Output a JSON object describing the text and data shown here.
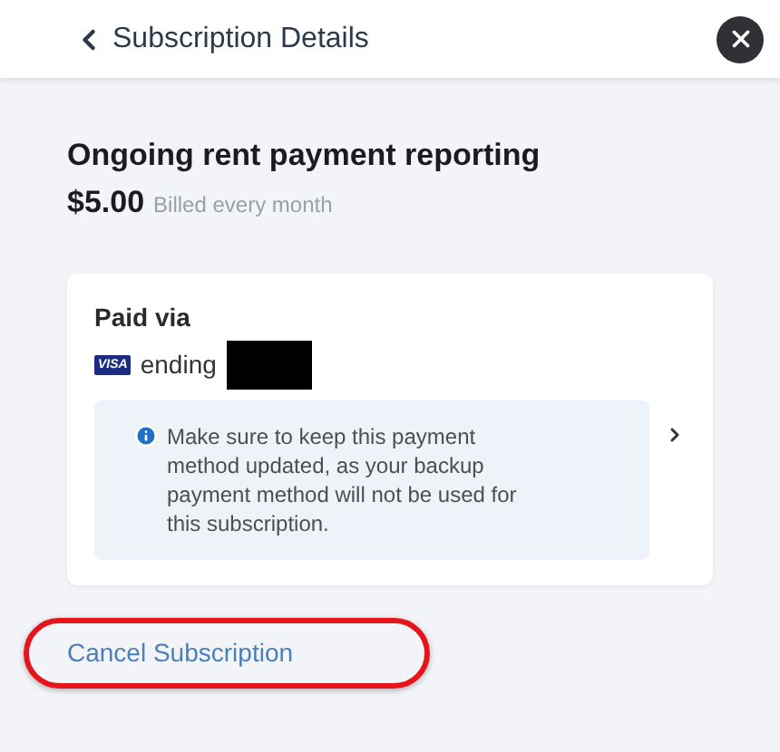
{
  "header": {
    "back_label": "Subscription Details"
  },
  "subscription": {
    "title": "Ongoing rent payment reporting",
    "price": "$5.00",
    "billing": "Billed every month"
  },
  "payment": {
    "heading": "Paid via",
    "card_brand": "VISA",
    "ending_label": "ending",
    "notice": "Make sure to keep this payment method updated, as your backup payment method will not be used for this subscription."
  },
  "cancel_link": "Cancel Subscription"
}
